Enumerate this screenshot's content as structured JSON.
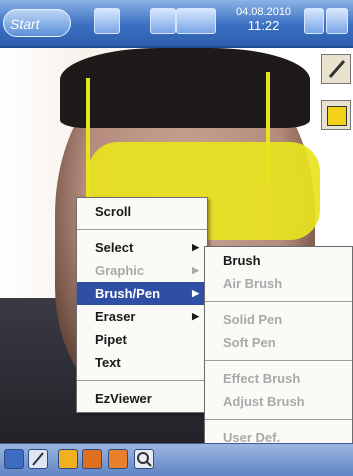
{
  "taskbar": {
    "start_label": "Start",
    "date_line": "04.08.2010",
    "time_line": "11:22"
  },
  "context_menu": {
    "items": [
      "Scroll",
      "Select",
      "Graphic",
      "Brush/Pen",
      "Eraser",
      "Pipet",
      "Text",
      "EzViewer"
    ]
  },
  "submenu": {
    "items": [
      "Brush",
      "Air Brush",
      "Solid Pen",
      "Soft Pen",
      "Effect Brush",
      "Adjust Brush",
      "User Def."
    ]
  },
  "colors": {
    "brush_color": "#e8e41e",
    "menu_highlight": "#2e4fa3"
  },
  "icons": {
    "taskbar": [
      "start-icon",
      "program-icon",
      "signal-icon",
      "calendar-icon",
      "volume-icon",
      "close-icon"
    ],
    "bottombar": [
      "info-icon",
      "pen-icon",
      "pause-icon",
      "brush-icon",
      "eraser-icon",
      "zoom-icon"
    ]
  }
}
